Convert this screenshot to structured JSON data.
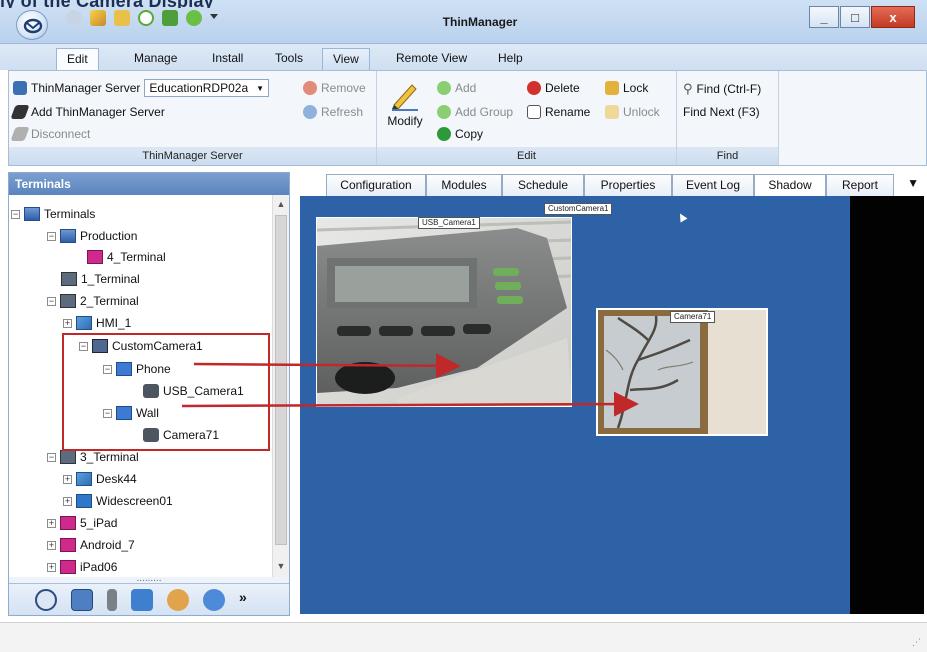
{
  "window": {
    "title_cropped": "ly of the Camera Display",
    "app_title": "ThinManager",
    "minimize": "_",
    "maximize": "□",
    "close": "x"
  },
  "menu": [
    "Edit",
    "Manage",
    "Install",
    "Tools",
    "View",
    "Remote View",
    "Help"
  ],
  "ribbon": {
    "server_group": {
      "label": "ThinManager Server",
      "server_label": "ThinManager Server",
      "server_value": "EducationRDP02a",
      "remove": "Remove",
      "refresh": "Refresh",
      "add_server": "Add ThinManager Server",
      "disconnect": "Disconnect"
    },
    "edit_group": {
      "label": "Edit",
      "modify": "Modify",
      "add": "Add",
      "add_group": "Add Group",
      "copy": "Copy",
      "delete": "Delete",
      "rename": "Rename",
      "lock": "Lock",
      "unlock": "Unlock"
    },
    "find_group": {
      "label": "Find",
      "find": "Find (Ctrl-F)",
      "find_next": "Find Next (F3)"
    }
  },
  "left_panel": {
    "header": "Terminals",
    "tree": [
      {
        "label": "Terminals"
      },
      {
        "label": "Production"
      },
      {
        "label": "4_Terminal"
      },
      {
        "label": "1_Terminal"
      },
      {
        "label": "2_Terminal"
      },
      {
        "label": "HMI_1"
      },
      {
        "label": "CustomCamera1"
      },
      {
        "label": "Phone"
      },
      {
        "label": "USB_Camera1"
      },
      {
        "label": "Wall"
      },
      {
        "label": "Camera71"
      },
      {
        "label": "3_Terminal"
      },
      {
        "label": "Desk44"
      },
      {
        "label": "Widescreen01"
      },
      {
        "label": "5_iPad"
      },
      {
        "label": "Android_7"
      },
      {
        "label": "iPad06"
      }
    ],
    "splitter": "........."
  },
  "content_tabs": [
    "Configuration",
    "Modules",
    "Schedule",
    "Properties",
    "Event Log",
    "Shadow",
    "Report"
  ],
  "shadow": {
    "overlay_label": "CustomCamera1",
    "camera1_label": "USB_Camera1",
    "camera2_label": "Camera71"
  },
  "colors": {
    "shadow_bg": "#2e62a6",
    "annotation_red": "#c0282a",
    "panel_header": "#5a84bd"
  }
}
